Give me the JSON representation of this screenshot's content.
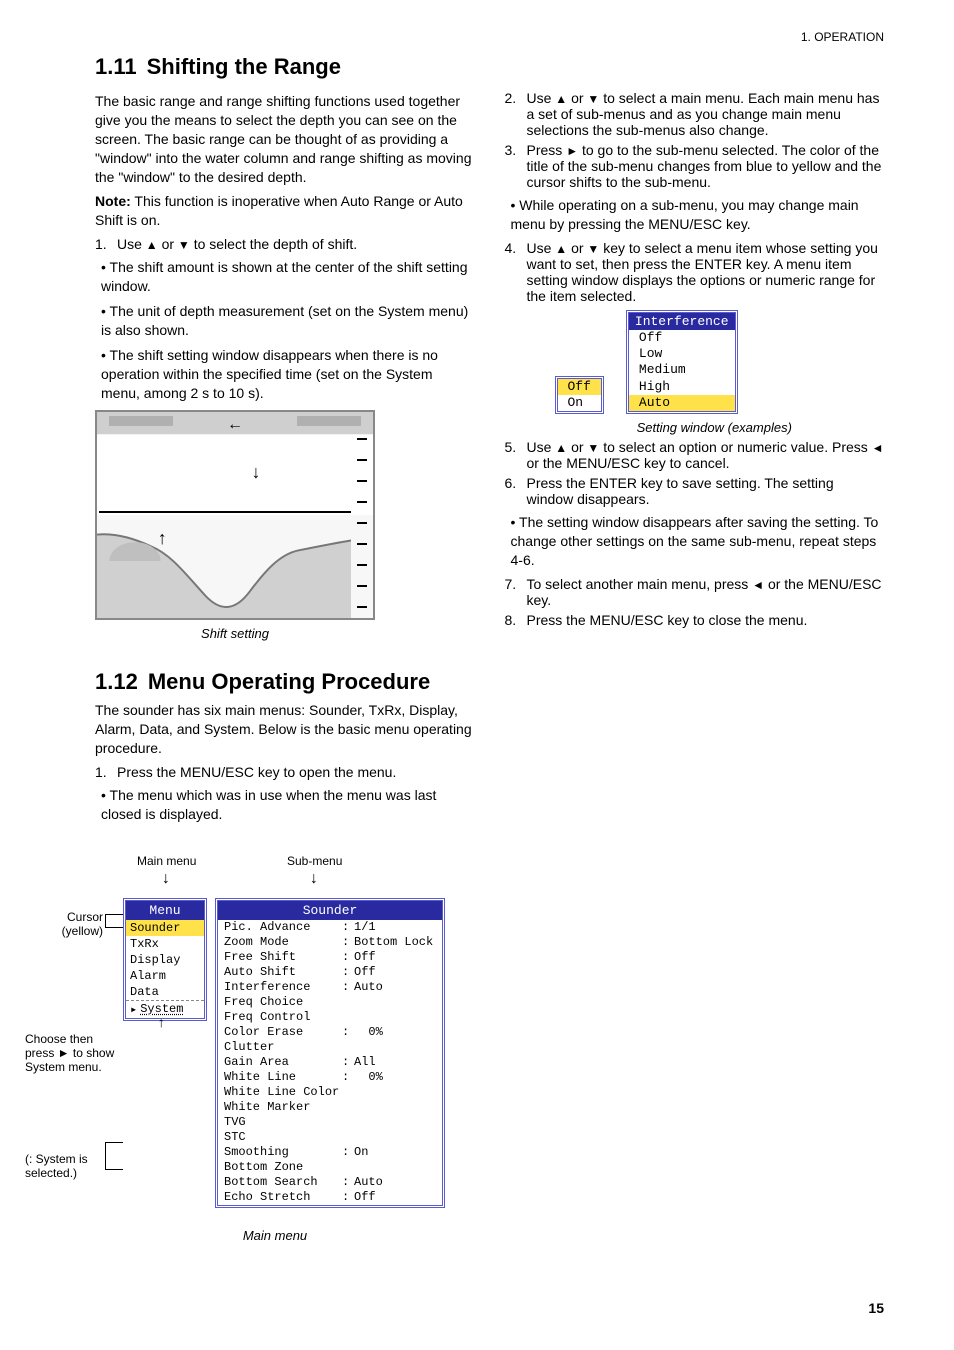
{
  "page_header": "1. OPERATION",
  "page_number": "15",
  "left": {
    "section_no": "1.11",
    "section_title": "Shifting the Range",
    "para1": "The basic range and range shifting functions used together give you the means to select the depth you can see on the screen. The basic range can be thought of as providing a \"window\" into the water column and range shifting as moving the \"window\" to the desired depth.",
    "note_label": "Note:",
    "note_text": " This function is inoperative when Auto Range or Auto Shift is on.",
    "step1_n": "1.",
    "step1_t_a": "Use ",
    "step1_t_b": " or ",
    "step1_t_c": " to select the depth of shift.",
    "bullet1": "• The shift amount is shown at the center of the shift setting window.",
    "bullet2": "• The unit of depth measurement (set on the System menu) is also shown.",
    "bullet3": "• The shift setting window disappears when there is no operation within the specified time (set on the System menu, among 2 s to 10 s).",
    "fig_caption": "Shift setting",
    "sub_no": "1.12",
    "sub_title": "Menu Operating Procedure",
    "para2": "The sounder has six main menus: Sounder, TxRx, Display, Alarm, Data, and System. Below is the basic menu operating procedure.",
    "sm_step1_n": "1.",
    "sm_step1_t": "Press the MENU/ESC key to open the menu.",
    "sm_bullet": "• The menu which was in use when the menu was last closed is displayed.",
    "diagram": {
      "label_main": "Main menu",
      "label_sub": "Sub-menu",
      "label_cursor": "Cursor (yellow)",
      "label_choose": "Choose   then press ► to show System menu.",
      "label_sys_note": "(: System is selected.)",
      "main_title": "Menu",
      "main_items": [
        "Sounder",
        "TxRx",
        "Display",
        "Alarm",
        "Data"
      ],
      "main_system": "System",
      "sub_title": "Sounder",
      "rows": [
        {
          "k": "Pic. Advance",
          "v": "1/1"
        },
        {
          "k": "Zoom Mode",
          "v": "Bottom Lock"
        },
        {
          "k": "Free Shift",
          "v": "Off"
        },
        {
          "k": "Auto Shift",
          "v": "Off"
        },
        {
          "k": "Interference",
          "v": "Auto"
        },
        {
          "k": "Freq Choice",
          "v": ""
        },
        {
          "k": "Freq Control",
          "v": ""
        },
        {
          "k": "Color Erase",
          "v": "  0%"
        },
        {
          "k": "Clutter",
          "v": ""
        },
        {
          "k": "Gain Area",
          "v": "All"
        },
        {
          "k": "White Line",
          "v": "  0%"
        },
        {
          "k": "White Line Color",
          "v": ""
        },
        {
          "k": "White Marker",
          "v": ""
        },
        {
          "k": "TVG",
          "v": ""
        },
        {
          "k": "STC",
          "v": ""
        },
        {
          "k": "Smoothing",
          "v": "On"
        },
        {
          "k": "Bottom Zone",
          "v": ""
        },
        {
          "k": "Bottom Search",
          "v": "Auto"
        },
        {
          "k": "Echo Stretch",
          "v": "Off"
        }
      ],
      "caption": "Main menu"
    }
  },
  "right": {
    "r_step2_n": "2.",
    "r_step2_a": "Use ",
    "r_step2_b": " or ",
    "r_step2_c": " to select a main menu. Each main menu has a set of sub-menus and as you change main menu selections the sub-menus also change.",
    "r_step3_n": "3.",
    "r_step3_a": "Press ",
    "r_step3_b": " to go to the sub-menu selected. The color of the title of the sub-menu changes from blue to yellow and the cursor shifts to the sub-menu.",
    "r_note": "• While operating on a sub-menu, you may change main menu by pressing the MENU/ESC key.",
    "r_step4_n": "4.",
    "r_step4_a": "Use ",
    "r_step4_b": " or ",
    "r_step4_c": " key to select a menu item whose setting you want to set, then press the ENTER key. A menu item setting window displays the options or numeric range for the item selected.",
    "tiny_left": {
      "items": [
        "Off",
        "On"
      ]
    },
    "tiny_right": {
      "title": "Interference",
      "items": [
        "Off",
        "Low",
        "Medium",
        "High",
        "Auto"
      ]
    },
    "tiny_caption": "Setting window (examples)",
    "r_step5_n": "5.",
    "r_step5_a": "Use ",
    "r_step5_b": " or ",
    "r_step5_c": " to select an option or numeric value. Press ",
    "r_step5_d": " or the MENU/ESC key to cancel.",
    "r_step6_n": "6.",
    "r_step6_t": "Press the ENTER key to save setting. The setting window disappears.",
    "r_bullet6": "• The setting window disappears after saving the setting. To change other settings on the same sub-menu, repeat steps 4-6.",
    "r_step7_n": "7.",
    "r_step7_a": "To select another main menu, press ",
    "r_step7_b": " or the MENU/ESC key.",
    "r_step8_n": "8.",
    "r_step8_t": "Press the MENU/ESC key to close the menu."
  }
}
